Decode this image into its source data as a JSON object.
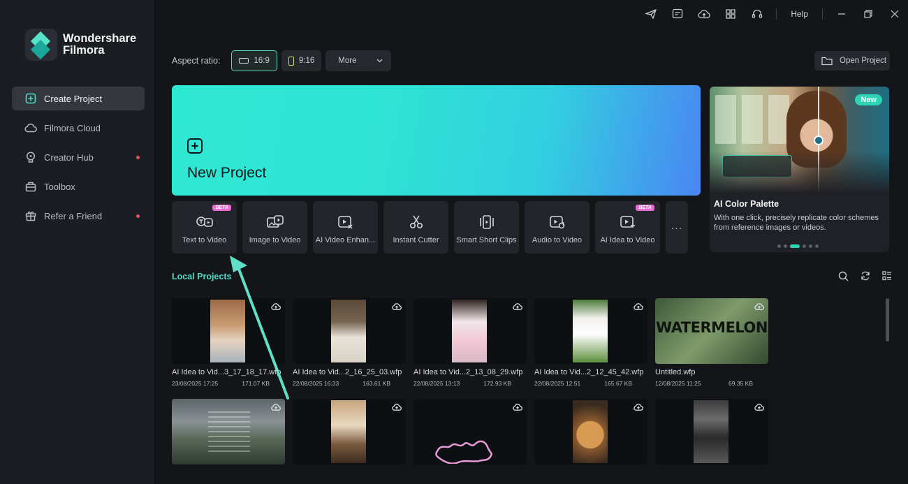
{
  "app": {
    "brand_line1": "Wondershare",
    "brand_line2": "Filmora"
  },
  "sidebar": {
    "items": [
      {
        "label": "Create Project",
        "icon": "plus-square-icon",
        "active": true,
        "dot": false
      },
      {
        "label": "Filmora Cloud",
        "icon": "cloud-icon",
        "active": false,
        "dot": false
      },
      {
        "label": "Creator Hub",
        "icon": "bulb-icon",
        "active": false,
        "dot": true
      },
      {
        "label": "Toolbox",
        "icon": "toolbox-icon",
        "active": false,
        "dot": false
      },
      {
        "label": "Refer a Friend",
        "icon": "gift-icon",
        "active": false,
        "dot": true
      }
    ]
  },
  "titlebar": {
    "icons": [
      "send-icon",
      "message-icon",
      "cloud-upload-icon",
      "grid-icon",
      "headset-icon"
    ],
    "help_label": "Help"
  },
  "aspect": {
    "label": "Aspect ratio:",
    "options": [
      "16:9",
      "9:16"
    ],
    "selected": "16:9",
    "more_label": "More"
  },
  "open_project_label": "Open Project",
  "new_project_label": "New Project",
  "tools": [
    {
      "label": "Text to Video",
      "icon": "text-to-video-icon",
      "beta": true
    },
    {
      "label": "Image to Video",
      "icon": "image-to-video-icon",
      "beta": false
    },
    {
      "label": "AI Video Enhan...",
      "icon": "video-enhancer-icon",
      "beta": false
    },
    {
      "label": "Instant Cutter",
      "icon": "scissors-icon",
      "beta": false
    },
    {
      "label": "Smart Short Clips",
      "icon": "short-clips-icon",
      "beta": false
    },
    {
      "label": "Audio to Video",
      "icon": "audio-to-video-icon",
      "beta": false
    },
    {
      "label": "AI Idea to Video",
      "icon": "idea-to-video-icon",
      "beta": true
    }
  ],
  "beta_label": "BETA",
  "tools_more": "···",
  "promo": {
    "badge": "New",
    "title": "AI Color Palette",
    "description": "With one click, precisely replicate color schemes from reference images or videos.",
    "page_count": 6,
    "current_page": 3
  },
  "local_projects": {
    "title": "Local Projects",
    "row1": [
      {
        "name": "AI Idea to Vid...3_17_18_17.wfp",
        "date": "23/08/2025 17:25",
        "size": "171.07 KB"
      },
      {
        "name": "AI Idea to Vid...2_16_25_03.wfp",
        "date": "22/08/2025 16:33",
        "size": "163.61 KB"
      },
      {
        "name": "AI Idea to Vid...2_13_08_29.wfp",
        "date": "22/08/2025 13:13",
        "size": "172.93 KB"
      },
      {
        "name": "AI Idea to Vid...2_12_45_42.wfp",
        "date": "22/08/2025 12:51",
        "size": "165.67 KB"
      },
      {
        "name": "Untitled.wfp",
        "date": "12/08/2025 11:25",
        "size": "69.35 KB"
      }
    ],
    "watermelon_text": "WATERMELON"
  },
  "colors": {
    "accent": "#4fdcc4",
    "badge_dot": "#ef4f55",
    "beta": "#e66bd2"
  }
}
